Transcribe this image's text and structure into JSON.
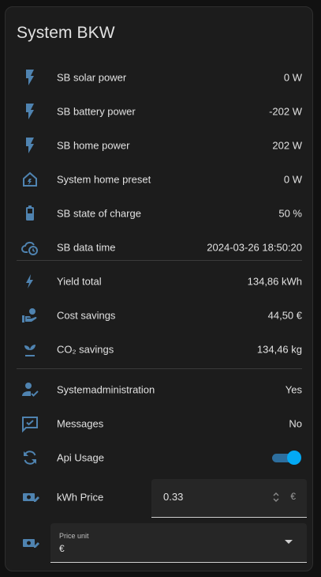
{
  "card": {
    "title": "System BKW"
  },
  "rows": [
    {
      "label": "SB solar power",
      "value": "0 W",
      "icon": "flash-icon"
    },
    {
      "label": "SB battery power",
      "value": "-202 W",
      "icon": "flash-icon"
    },
    {
      "label": "SB home power",
      "value": "202 W",
      "icon": "flash-icon"
    },
    {
      "label": "System home preset",
      "value": "0 W",
      "icon": "home-lightning-icon"
    },
    {
      "label": "SB state of charge",
      "value": "50 %",
      "icon": "battery-icon"
    },
    {
      "label": "SB data time",
      "value": "2024-03-26 18:50:20",
      "icon": "cloud-clock-icon"
    },
    {
      "label": "Yield total",
      "value": "134,86 kWh",
      "icon": "lightning-bolt-icon"
    },
    {
      "label": "Cost savings",
      "value": "44,50 €",
      "icon": "hand-coin-icon"
    },
    {
      "label": "CO₂ savings",
      "value": "134,46 kg",
      "icon": "sprout-icon"
    },
    {
      "label": "Systemadministration",
      "value": "Yes",
      "icon": "account-check-icon"
    },
    {
      "label": "Messages",
      "value": "No",
      "icon": "message-check-icon"
    },
    {
      "label": "Api Usage",
      "value": "",
      "icon": "sync-icon",
      "toggle_on": true
    },
    {
      "label": "kWh Price",
      "value": "",
      "icon": "cash-edit-icon"
    },
    {
      "label": "",
      "value": "",
      "icon": "cash-edit-icon"
    }
  ],
  "kwh_price": {
    "value": "0.33",
    "unit": "€"
  },
  "price_unit": {
    "label": "Price unit",
    "value": "€"
  },
  "colors": {
    "icon": "#4f83b0",
    "toggle_on": "#03a9f4",
    "card_bg": "#1c1c1c"
  }
}
